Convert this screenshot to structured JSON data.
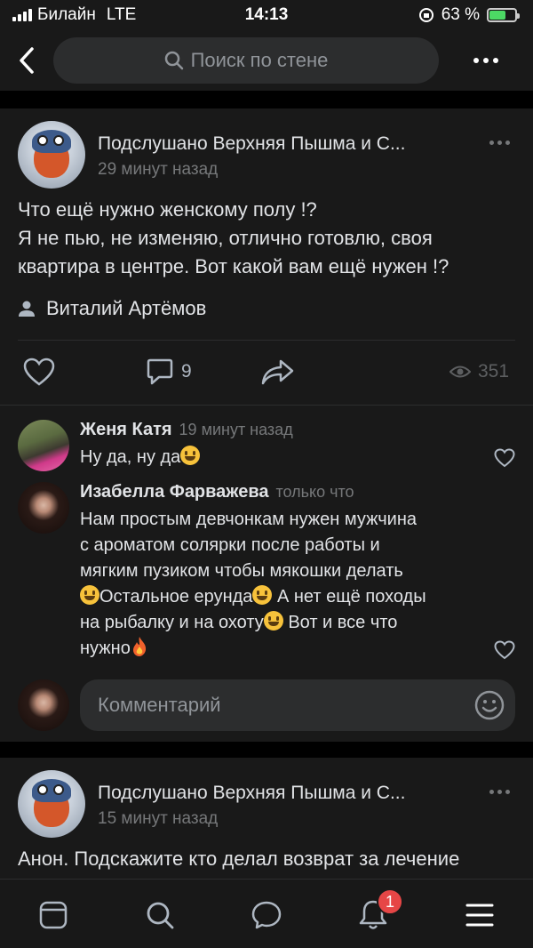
{
  "status_bar": {
    "carrier": "Билайн",
    "network": "LTE",
    "time": "14:13",
    "battery": "63 %",
    "battery_level": 0.63
  },
  "nav": {
    "search_placeholder": "Поиск по стене",
    "back_icon": "chevron-left-icon",
    "more_icon": "more-horizontal-icon"
  },
  "post1": {
    "group_name": "Подслушано Верхняя Пышма и С...",
    "time": "29 минут назад",
    "text_lines": [
      "Что ещё нужно женскому полу !?",
      "Я не пью, не изменяю, отлично готовлю, своя",
      "квартира в центре. Вот какой вам ещё нужен !?"
    ],
    "author": "Виталий Артёмов",
    "comments_count": "9",
    "views_count": "351"
  },
  "comments": [
    {
      "name": "Женя Катя",
      "time": "19 минут назад",
      "text_lines": [
        "Ну да, ну да"
      ]
    },
    {
      "name": "Изабелла Фарважева",
      "time": "только что",
      "text_lines": [
        "Нам простым девчонкам нужен  мужчина",
        "с ароматом солярки после работы и",
        "мягким пузиком чтобы мякошки делать",
        "Остальное ерунда",
        "А нет ещё походы",
        "на рыбалку и на охоту",
        "Вот и все что",
        "нужно"
      ]
    }
  ],
  "comment_input": {
    "placeholder": "Комментарий"
  },
  "post2": {
    "group_name": "Подслушано Верхняя Пышма и С...",
    "time": "15 минут назад",
    "text_line": "Анон. Подскажите кто делал возврат за лечение"
  },
  "tab_bar": {
    "notification_badge": "1",
    "icons": [
      "news-icon",
      "search-icon",
      "messages-icon",
      "notifications-icon",
      "menu-icon"
    ]
  },
  "colors": {
    "background": "#191919",
    "accent": "#e64646",
    "secondary_text": "#76787a"
  }
}
